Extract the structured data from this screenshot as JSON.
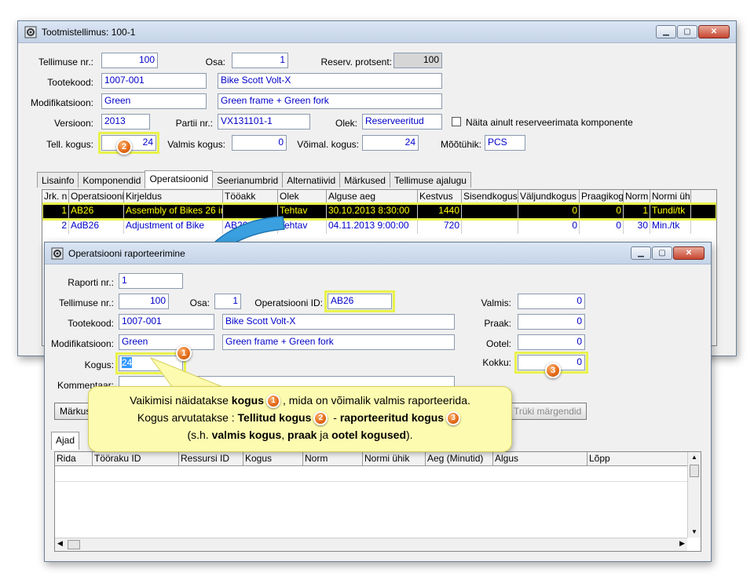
{
  "w1": {
    "title": "Tootmistellimus: 100-1",
    "lbl_tellimuse": "Tellimuse nr.:",
    "tellimuse": "100",
    "lbl_osa": "Osa:",
    "osa": "1",
    "lbl_reserv": "Reserv. protsent:",
    "reserv": "100",
    "lbl_tootekood": "Tootekood:",
    "tootekood": "1007-001",
    "toote_nimi": "Bike Scott Volt-X",
    "lbl_modif": "Modifikatsioon:",
    "modif": "Green",
    "modif_kirj": "Green frame + Green fork",
    "lbl_versioon": "Versioon:",
    "versioon": "2013",
    "lbl_partii": "Partii nr.:",
    "partii": "VX131101-1",
    "lbl_olek": "Olek:",
    "olek": "Reserveeritud",
    "chk_label": "Näita ainult reserveerimata komponente",
    "lbl_tell_kogus": "Tell. kogus:",
    "tell_kogus": "24",
    "lbl_valmis": "Valmis kogus:",
    "valmis": "0",
    "lbl_voimal": "Võimal. kogus:",
    "voimal": "24",
    "lbl_mootuhik": "Mõõtühik:",
    "mootuhik": "PCS",
    "tabs": [
      "Lisainfo",
      "Komponendid",
      "Operatsioonid",
      "Seerianumbrid",
      "Alternatiivid",
      "Märkused",
      "Tellimuse ajalugu"
    ],
    "cols": [
      "Jrk. n",
      "Operatsiooni",
      "Kirjeldus",
      "Tööakk",
      "Olek",
      "Alguse aeg",
      "Kestvus",
      "Sisendkogus",
      "Väljundkogus",
      "Praagikog",
      "Norm",
      "Normi üh"
    ],
    "rows": [
      [
        "1",
        "AB26",
        "Assembly of Bikes 26 in",
        "",
        "Tehtav",
        "30.10.2013 8:30:00",
        "1440",
        "",
        "0",
        "0",
        "1",
        "Tundi/tk"
      ],
      [
        "2",
        "AdB26",
        "Adjustment of Bike",
        "AB26",
        "Tehtav",
        "04.11.2013 9:00:00",
        "720",
        "",
        "0",
        "0",
        "30",
        "Min./tk"
      ]
    ]
  },
  "w2": {
    "title": "Operatsiooni raporteerimine",
    "lbl_raport": "Raporti nr.:",
    "raport": "1",
    "lbl_tellimuse": "Tellimuse nr.:",
    "tellimuse": "100",
    "lbl_osa": "Osa:",
    "osa": "1",
    "lbl_opid": "Operatsiooni ID:",
    "opid": "AB26",
    "lbl_tootekood": "Tootekood:",
    "tootekood": "1007-001",
    "toote_nimi": "Bike Scott Volt-X",
    "lbl_modif": "Modifikatsioon:",
    "modif": "Green",
    "modif_kirj": "Green frame + Green fork",
    "lbl_kogus": "Kogus:",
    "kogus": "24",
    "lbl_kommentaar": "Kommentaar:",
    "lbl_valmis": "Valmis:",
    "valmis": "0",
    "lbl_praak": "Praak:",
    "praak": "0",
    "lbl_ootel": "Ootel:",
    "ootel": "0",
    "lbl_kokku": "Kokku:",
    "kokku": "0",
    "btn_markused": "Märkus",
    "btn_print": "Trüki märgendid",
    "tab_ajad": "Ajad",
    "cols": [
      "Rida",
      "Tööraku ID",
      "Ressursi ID",
      "Kogus",
      "Norm",
      "Normi ühik",
      "Aeg (Minutid)",
      "Algus",
      "Lõpp"
    ]
  },
  "callout": {
    "l1a": "Vaikimisi näidatakse ",
    "l1b": "kogus",
    "l1c": ", mida on võimalik valmis raporteerida.",
    "l2a": "Kogus arvutatakse : ",
    "l2b": "Tellitud kogus",
    "l2c": " - ",
    "l2d": "raporteeritud kogus",
    "l3a": "(s.h. ",
    "l3b": "valmis kogus",
    "l3c": ", ",
    "l3d": "praak",
    "l3e": " ja ",
    "l3f": "ootel kogused",
    "l3g": ")."
  },
  "badges": [
    "1",
    "2",
    "3"
  ],
  "colors": {
    "accent": "#e46a16",
    "highlight": "#e9f24a",
    "arrow": "#3aa0e0"
  }
}
